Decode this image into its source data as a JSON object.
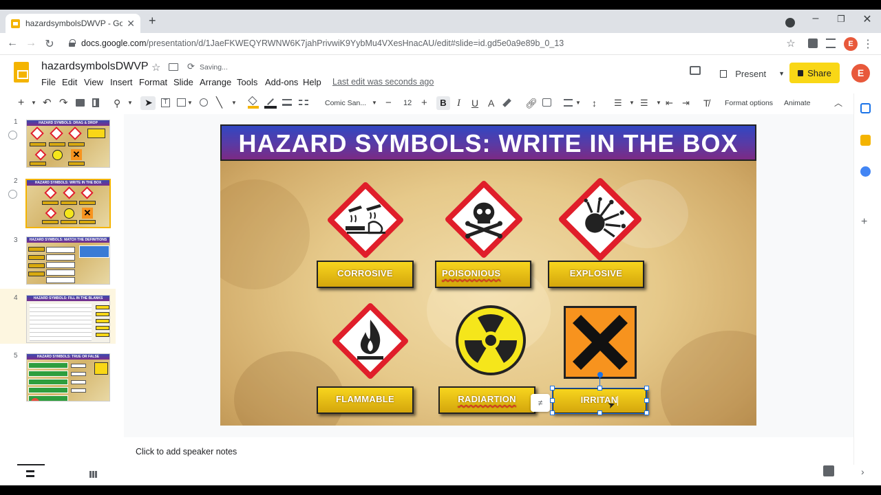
{
  "browser": {
    "tab_title": "hazardsymbolsDWVP - Google ...",
    "new_tab": "+",
    "close_tab": "✕",
    "url_domain": "docs.google.com",
    "url_path": "/presentation/d/1JaeFKWEQYRWNW6K7jahPrivwiK9YybMu4VXesHnacAU/edit#slide=id.gd5e0a9e89b_0_13",
    "profile_initial": "E"
  },
  "app": {
    "doc_title": "hazardsymbolsDWVP",
    "saving": "Saving...",
    "menus": [
      "File",
      "Edit",
      "View",
      "Insert",
      "Format",
      "Slide",
      "Arrange",
      "Tools",
      "Add-ons",
      "Help"
    ],
    "last_edit": "Last edit was seconds ago",
    "present_label": "Present",
    "share_label": "Share",
    "account_initial": "E"
  },
  "toolbar": {
    "font_name": "Comic San...",
    "font_size": "12",
    "format_options": "Format options",
    "animate": "Animate"
  },
  "thumbnails": [
    {
      "number": "1",
      "title": "HAZARD SYMBOLS: DRAG & DROP"
    },
    {
      "number": "2",
      "title": "HAZARD SYMBOLS: WRITE IN THE BOX"
    },
    {
      "number": "3",
      "title": "HAZARD SYMBOLS: MATCH THE DEFINITIONS"
    },
    {
      "number": "4",
      "title": "HAZARD SYMBOLS: FILL IN THE BLANKS"
    },
    {
      "number": "5",
      "title": "HAZARD SYMBOLS: TRUE OR FALSE"
    }
  ],
  "slide": {
    "title": "HAZARD SYMBOLS: WRITE IN THE BOX",
    "labels": [
      "CORROSIVE",
      "POISONIOUS",
      "EXPLOSIVE",
      "FLAMMABLE",
      "RADIARTION",
      "IRRITAN"
    ]
  },
  "notes_placeholder": "Click to add speaker notes",
  "colors": {
    "accent_yellow": "#f9d716",
    "selection_blue": "#1a73e8",
    "header_blue": "#3147c2",
    "header_purple": "#7c2a84",
    "ghs_red": "#e01e2a",
    "irritant_orange": "#f7931e"
  }
}
